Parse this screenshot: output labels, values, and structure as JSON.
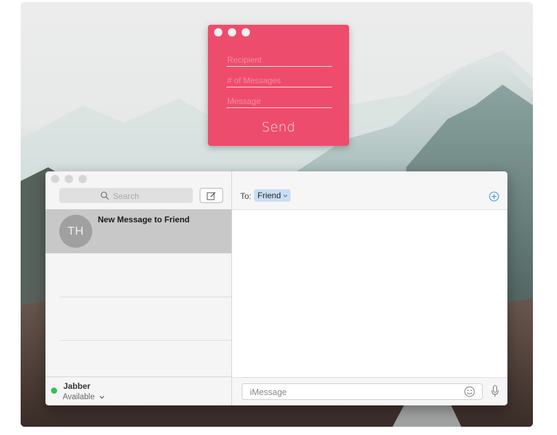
{
  "sender_window": {
    "recipient_placeholder": "Recipient",
    "count_placeholder": "# of Messages",
    "message_placeholder": "Message",
    "send_label": "Send",
    "color": "#ee4c6c"
  },
  "messages_app": {
    "search_placeholder": "Search",
    "conversations": [
      {
        "initials": "TH",
        "title": "New Message to Friend"
      }
    ],
    "account": {
      "name": "Jabber",
      "status": "Available",
      "status_color": "#2fc455"
    },
    "to_label": "To:",
    "recipient": "Friend",
    "message_placeholder": "iMessage"
  },
  "icons": [
    "search-icon",
    "compose-icon",
    "add-contact-icon",
    "emoji-icon",
    "microphone-icon",
    "chevron-down-icon"
  ]
}
